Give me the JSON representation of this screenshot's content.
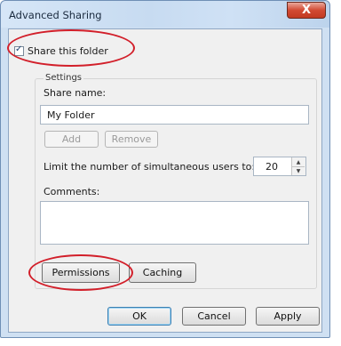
{
  "window": {
    "title": "Advanced Sharing",
    "close_label": "X"
  },
  "share": {
    "checked": true,
    "label": "Share this folder"
  },
  "settings": {
    "group_label": "Settings",
    "share_name_label": "Share name:",
    "share_name_value": "My Folder",
    "add_label": "Add",
    "remove_label": "Remove",
    "limit_label": "Limit the number of simultaneous users to:",
    "limit_value": "20",
    "comments_label": "Comments:",
    "comments_value": ""
  },
  "buttons": {
    "permissions": "Permissions",
    "caching": "Caching",
    "ok": "OK",
    "cancel": "Cancel",
    "apply": "Apply"
  },
  "colors": {
    "highlight_ring": "#d21f2a",
    "titlebar": "#c7dbf1",
    "close_button": "#d24a33"
  }
}
